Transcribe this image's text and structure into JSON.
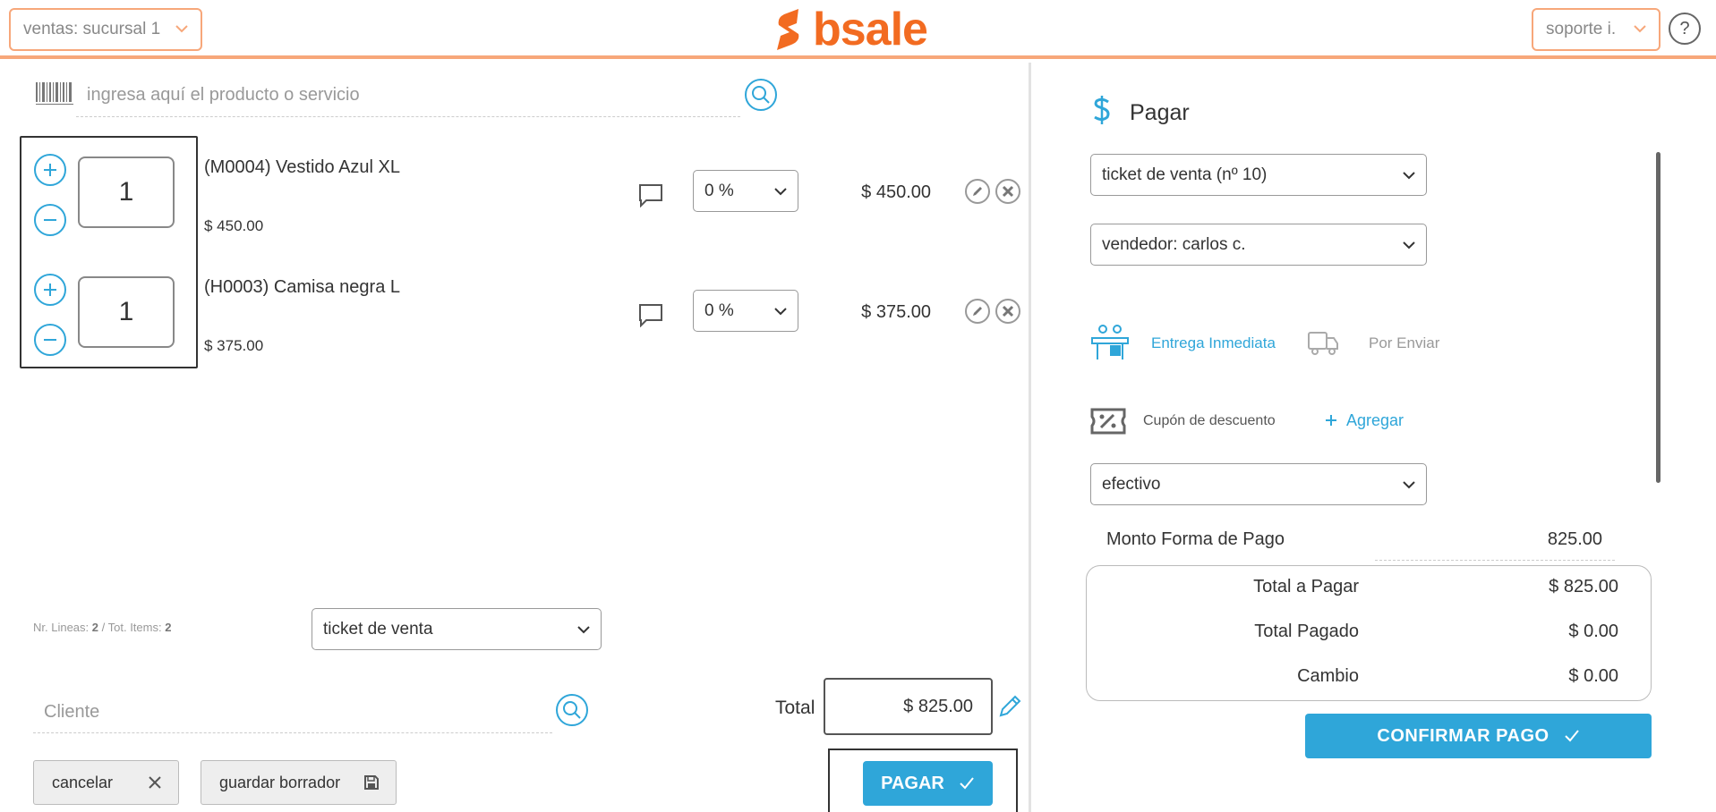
{
  "header": {
    "branch_select": "ventas: sucursal 1",
    "logo_text": "bsale",
    "user_select": "soporte i.",
    "help_label": "?"
  },
  "colors": {
    "brand_orange": "#f26b21",
    "accent_blue": "#2fa6d9",
    "border_orange": "#f7a77a"
  },
  "product_search": {
    "placeholder": "ingresa aquí el producto o servicio"
  },
  "items": [
    {
      "quantity": "1",
      "name": "(M0004) Vestido Azul XL",
      "unit_price": "$ 450.00",
      "discount": "0 %",
      "line_total": "$ 450.00"
    },
    {
      "quantity": "1",
      "name": "(H0003) Camisa negra L",
      "unit_price": "$ 375.00",
      "discount": "0 %",
      "line_total": "$ 375.00"
    }
  ],
  "summary": {
    "lines_label": "Nr. Lineas:",
    "lines_count": "2",
    "items_label": "/ Tot. Items:",
    "items_count": "2"
  },
  "doc_type_select": "ticket de venta",
  "client": {
    "placeholder": "Cliente"
  },
  "total": {
    "label": "Total",
    "value": "$ 825.00"
  },
  "actions": {
    "cancel_label": "cancelar",
    "draft_label": "guardar borrador",
    "pay_label": "PAGAR"
  },
  "payment": {
    "title": "Pagar",
    "document_select": "ticket de venta (nº 10)",
    "seller_select": "vendedor: carlos c.",
    "delivery_immediate": "Entrega Inmediata",
    "delivery_ship": "Por Enviar",
    "coupon_label": "Cupón de descuento",
    "coupon_add": "Agregar",
    "method_select": "efectivo",
    "amount_label": "Monto Forma de Pago",
    "amount_value": "825.00",
    "total_to_pay_label": "Total a Pagar",
    "total_to_pay": "$ 825.00",
    "total_paid_label": "Total Pagado",
    "total_paid": "$ 0.00",
    "change_label": "Cambio",
    "change": "$ 0.00",
    "confirm_label": "CONFIRMAR PAGO"
  }
}
